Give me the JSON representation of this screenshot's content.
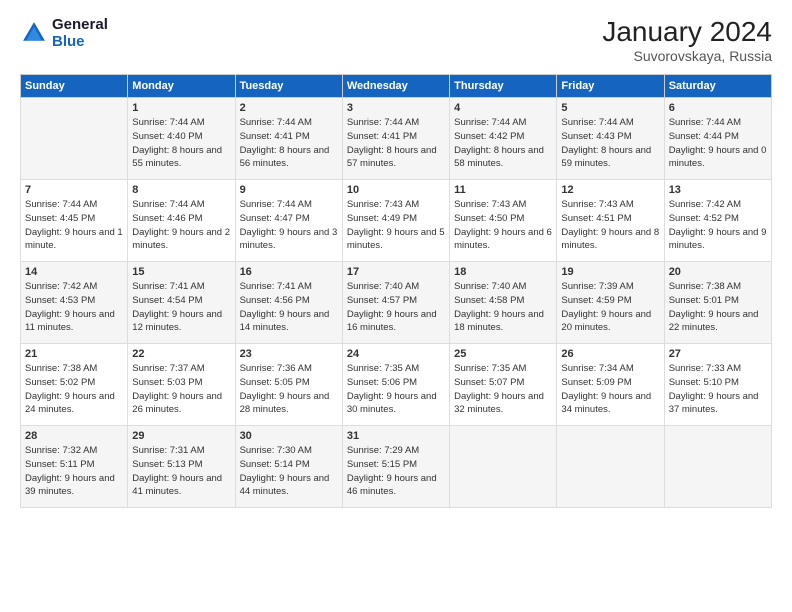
{
  "logo": {
    "line1": "General",
    "line2": "Blue"
  },
  "title": "January 2024",
  "subtitle": "Suvorovskaya, Russia",
  "days_of_week": [
    "Sunday",
    "Monday",
    "Tuesday",
    "Wednesday",
    "Thursday",
    "Friday",
    "Saturday"
  ],
  "weeks": [
    [
      {
        "day": "",
        "sunrise": "",
        "sunset": "",
        "daylight": ""
      },
      {
        "day": "1",
        "sunrise": "Sunrise: 7:44 AM",
        "sunset": "Sunset: 4:40 PM",
        "daylight": "Daylight: 8 hours and 55 minutes."
      },
      {
        "day": "2",
        "sunrise": "Sunrise: 7:44 AM",
        "sunset": "Sunset: 4:41 PM",
        "daylight": "Daylight: 8 hours and 56 minutes."
      },
      {
        "day": "3",
        "sunrise": "Sunrise: 7:44 AM",
        "sunset": "Sunset: 4:41 PM",
        "daylight": "Daylight: 8 hours and 57 minutes."
      },
      {
        "day": "4",
        "sunrise": "Sunrise: 7:44 AM",
        "sunset": "Sunset: 4:42 PM",
        "daylight": "Daylight: 8 hours and 58 minutes."
      },
      {
        "day": "5",
        "sunrise": "Sunrise: 7:44 AM",
        "sunset": "Sunset: 4:43 PM",
        "daylight": "Daylight: 8 hours and 59 minutes."
      },
      {
        "day": "6",
        "sunrise": "Sunrise: 7:44 AM",
        "sunset": "Sunset: 4:44 PM",
        "daylight": "Daylight: 9 hours and 0 minutes."
      }
    ],
    [
      {
        "day": "7",
        "sunrise": "Sunrise: 7:44 AM",
        "sunset": "Sunset: 4:45 PM",
        "daylight": "Daylight: 9 hours and 1 minute."
      },
      {
        "day": "8",
        "sunrise": "Sunrise: 7:44 AM",
        "sunset": "Sunset: 4:46 PM",
        "daylight": "Daylight: 9 hours and 2 minutes."
      },
      {
        "day": "9",
        "sunrise": "Sunrise: 7:44 AM",
        "sunset": "Sunset: 4:47 PM",
        "daylight": "Daylight: 9 hours and 3 minutes."
      },
      {
        "day": "10",
        "sunrise": "Sunrise: 7:43 AM",
        "sunset": "Sunset: 4:49 PM",
        "daylight": "Daylight: 9 hours and 5 minutes."
      },
      {
        "day": "11",
        "sunrise": "Sunrise: 7:43 AM",
        "sunset": "Sunset: 4:50 PM",
        "daylight": "Daylight: 9 hours and 6 minutes."
      },
      {
        "day": "12",
        "sunrise": "Sunrise: 7:43 AM",
        "sunset": "Sunset: 4:51 PM",
        "daylight": "Daylight: 9 hours and 8 minutes."
      },
      {
        "day": "13",
        "sunrise": "Sunrise: 7:42 AM",
        "sunset": "Sunset: 4:52 PM",
        "daylight": "Daylight: 9 hours and 9 minutes."
      }
    ],
    [
      {
        "day": "14",
        "sunrise": "Sunrise: 7:42 AM",
        "sunset": "Sunset: 4:53 PM",
        "daylight": "Daylight: 9 hours and 11 minutes."
      },
      {
        "day": "15",
        "sunrise": "Sunrise: 7:41 AM",
        "sunset": "Sunset: 4:54 PM",
        "daylight": "Daylight: 9 hours and 12 minutes."
      },
      {
        "day": "16",
        "sunrise": "Sunrise: 7:41 AM",
        "sunset": "Sunset: 4:56 PM",
        "daylight": "Daylight: 9 hours and 14 minutes."
      },
      {
        "day": "17",
        "sunrise": "Sunrise: 7:40 AM",
        "sunset": "Sunset: 4:57 PM",
        "daylight": "Daylight: 9 hours and 16 minutes."
      },
      {
        "day": "18",
        "sunrise": "Sunrise: 7:40 AM",
        "sunset": "Sunset: 4:58 PM",
        "daylight": "Daylight: 9 hours and 18 minutes."
      },
      {
        "day": "19",
        "sunrise": "Sunrise: 7:39 AM",
        "sunset": "Sunset: 4:59 PM",
        "daylight": "Daylight: 9 hours and 20 minutes."
      },
      {
        "day": "20",
        "sunrise": "Sunrise: 7:38 AM",
        "sunset": "Sunset: 5:01 PM",
        "daylight": "Daylight: 9 hours and 22 minutes."
      }
    ],
    [
      {
        "day": "21",
        "sunrise": "Sunrise: 7:38 AM",
        "sunset": "Sunset: 5:02 PM",
        "daylight": "Daylight: 9 hours and 24 minutes."
      },
      {
        "day": "22",
        "sunrise": "Sunrise: 7:37 AM",
        "sunset": "Sunset: 5:03 PM",
        "daylight": "Daylight: 9 hours and 26 minutes."
      },
      {
        "day": "23",
        "sunrise": "Sunrise: 7:36 AM",
        "sunset": "Sunset: 5:05 PM",
        "daylight": "Daylight: 9 hours and 28 minutes."
      },
      {
        "day": "24",
        "sunrise": "Sunrise: 7:35 AM",
        "sunset": "Sunset: 5:06 PM",
        "daylight": "Daylight: 9 hours and 30 minutes."
      },
      {
        "day": "25",
        "sunrise": "Sunrise: 7:35 AM",
        "sunset": "Sunset: 5:07 PM",
        "daylight": "Daylight: 9 hours and 32 minutes."
      },
      {
        "day": "26",
        "sunrise": "Sunrise: 7:34 AM",
        "sunset": "Sunset: 5:09 PM",
        "daylight": "Daylight: 9 hours and 34 minutes."
      },
      {
        "day": "27",
        "sunrise": "Sunrise: 7:33 AM",
        "sunset": "Sunset: 5:10 PM",
        "daylight": "Daylight: 9 hours and 37 minutes."
      }
    ],
    [
      {
        "day": "28",
        "sunrise": "Sunrise: 7:32 AM",
        "sunset": "Sunset: 5:11 PM",
        "daylight": "Daylight: 9 hours and 39 minutes."
      },
      {
        "day": "29",
        "sunrise": "Sunrise: 7:31 AM",
        "sunset": "Sunset: 5:13 PM",
        "daylight": "Daylight: 9 hours and 41 minutes."
      },
      {
        "day": "30",
        "sunrise": "Sunrise: 7:30 AM",
        "sunset": "Sunset: 5:14 PM",
        "daylight": "Daylight: 9 hours and 44 minutes."
      },
      {
        "day": "31",
        "sunrise": "Sunrise: 7:29 AM",
        "sunset": "Sunset: 5:15 PM",
        "daylight": "Daylight: 9 hours and 46 minutes."
      },
      {
        "day": "",
        "sunrise": "",
        "sunset": "",
        "daylight": ""
      },
      {
        "day": "",
        "sunrise": "",
        "sunset": "",
        "daylight": ""
      },
      {
        "day": "",
        "sunrise": "",
        "sunset": "",
        "daylight": ""
      }
    ]
  ]
}
